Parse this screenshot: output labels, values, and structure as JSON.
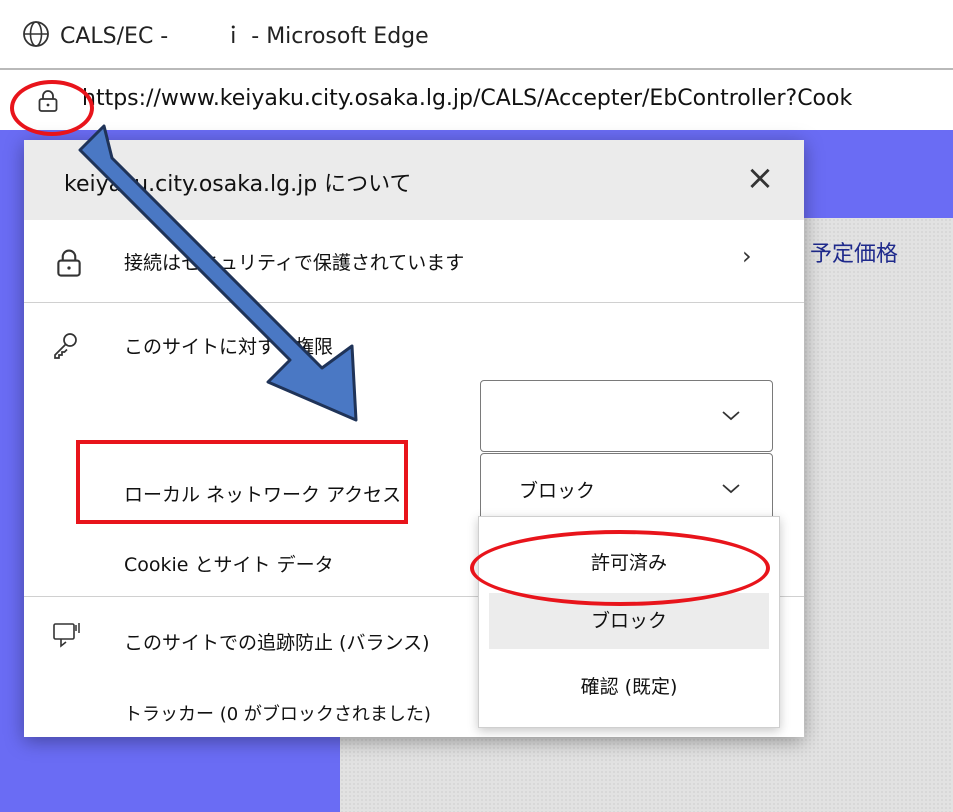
{
  "window": {
    "title_left": "CALS/EC -",
    "title_mid": "ｉ",
    "title_right": "- Microsoft Edge"
  },
  "address_bar": {
    "url": "https://www.keiyaku.city.osaka.lg.jp/CALS/Accepter/EbController?Cook"
  },
  "background_page": {
    "partial_text": "予定価格"
  },
  "site_info_flyout": {
    "title": "keiyaku.city.osaka.lg.jp について",
    "connection_row": "接続はセキュリティで保護されています",
    "permissions_heading": "このサイトに対する権限",
    "permission_first_value": "",
    "local_network_label": "ローカル ネットワーク アクセス",
    "local_network_value": "ブロック",
    "cookie_label": "Cookie とサイト データ",
    "tracking_heading": "このサイトでの追跡防止 (バランス)",
    "tracker_status": "トラッカー (0 がブロックされました)",
    "dropdown_options": [
      "許可済み",
      "ブロック",
      "確認 (既定)"
    ],
    "dropdown_hovered": "ブロック"
  },
  "annotations": {
    "color": "#e8141b",
    "arrow_color": "#4a78c4",
    "arrow_outline": "#1f3358"
  }
}
